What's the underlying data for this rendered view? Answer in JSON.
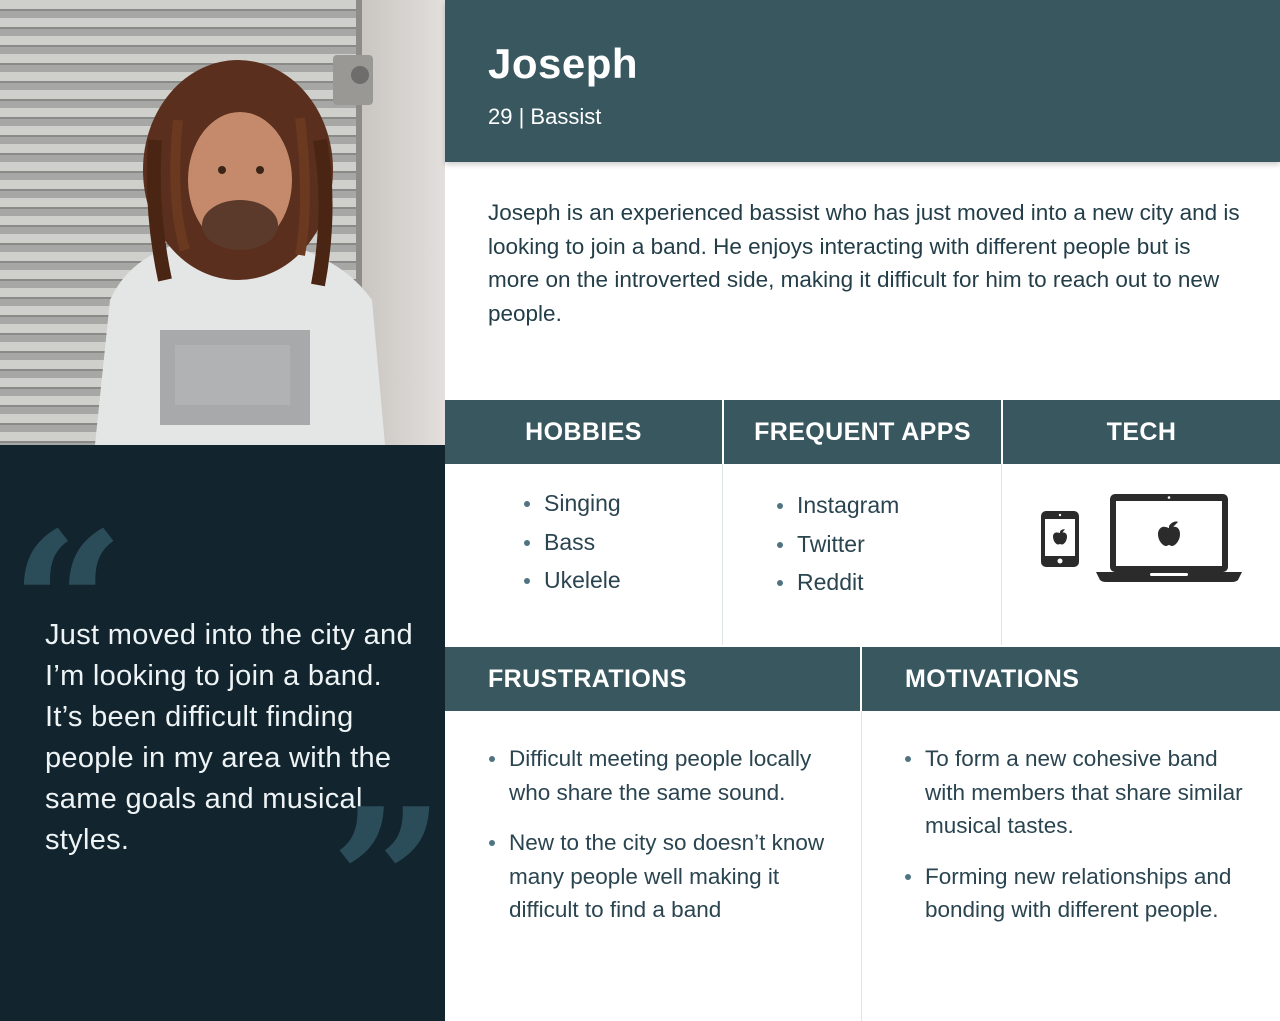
{
  "persona": {
    "name": "Joseph",
    "subtitle": "29 | Bassist",
    "bio": "Joseph is an experienced bassist who has just moved into a new city and is looking to join a band. He enjoys interacting with different people but is more on the introverted side, making it difficult for him to reach out to new people."
  },
  "quote": {
    "open_mark": "“",
    "close_mark": "”",
    "text": "Just moved into the city and I’m looking to join a band. It’s been difficult finding people in my area with the same goals and musical styles."
  },
  "hobbies": {
    "title": "HOBBIES",
    "items": [
      "Singing",
      "Bass",
      "Ukelele"
    ]
  },
  "apps": {
    "title": "FREQUENT APPS",
    "items": [
      "Instagram",
      "Twitter",
      "Reddit"
    ]
  },
  "tech": {
    "title": "TECH",
    "icons": [
      "smartphone-icon",
      "laptop-icon",
      "apple-logo-icon"
    ]
  },
  "frustrations": {
    "title": "FRUSTRATIONS",
    "items": [
      "Difficult meeting people locally who share the same sound.",
      "New to the city so doesn’t know many people well making it difficult to find a band"
    ]
  },
  "motivations": {
    "title": "MOTIVATIONS",
    "items": [
      "To form a new cohesive band with members that share similar musical tastes.",
      "Forming new relationships and bonding with different people."
    ]
  },
  "colors": {
    "header_bg": "#38575f",
    "quote_bg": "#12242d",
    "quote_mark": "#2b4d59",
    "text": "#233e48"
  }
}
